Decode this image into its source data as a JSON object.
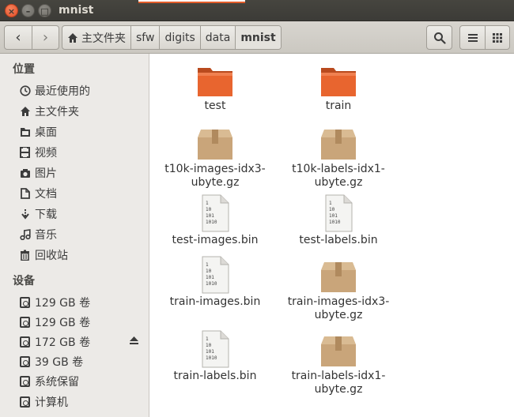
{
  "window": {
    "title": "mnist",
    "close_glyph": "×",
    "minimize_glyph": "–",
    "maximize_glyph": "□"
  },
  "toolbar": {
    "back_glyph": "‹",
    "forward_glyph": "›",
    "breadcrumbs": [
      {
        "label": "主文件夹",
        "icon": "home-icon"
      },
      {
        "label": "sfw"
      },
      {
        "label": "digits"
      },
      {
        "label": "data"
      },
      {
        "label": "mnist",
        "active": true
      }
    ]
  },
  "sidebar": {
    "places_heading": "位置",
    "places": [
      {
        "label": "最近使用的",
        "icon": "clock-icon"
      },
      {
        "label": "主文件夹",
        "icon": "home-icon"
      },
      {
        "label": "桌面",
        "icon": "desktop-icon"
      },
      {
        "label": "视频",
        "icon": "video-icon"
      },
      {
        "label": "图片",
        "icon": "camera-icon"
      },
      {
        "label": "文档",
        "icon": "document-icon"
      },
      {
        "label": "下载",
        "icon": "download-icon"
      },
      {
        "label": "音乐",
        "icon": "music-icon"
      },
      {
        "label": "回收站",
        "icon": "trash-icon"
      }
    ],
    "devices_heading": "设备",
    "devices": [
      {
        "label": "129 GB 卷",
        "icon": "drive-icon"
      },
      {
        "label": "129 GB 卷",
        "icon": "drive-icon"
      },
      {
        "label": "172 GB 卷",
        "icon": "drive-icon",
        "eject": true
      },
      {
        "label": "39 GB 卷",
        "icon": "drive-icon"
      },
      {
        "label": "系统保留",
        "icon": "drive-icon"
      },
      {
        "label": "计算机",
        "icon": "drive-icon"
      }
    ]
  },
  "files": [
    {
      "name_line1": "test",
      "name_line2": "",
      "type": "folder"
    },
    {
      "name_line1": "train",
      "name_line2": "",
      "type": "folder"
    },
    {
      "name_line1": "t10k-images-idx3-",
      "name_line2": "ubyte.gz",
      "type": "archive"
    },
    {
      "name_line1": "t10k-labels-idx1-",
      "name_line2": "ubyte.gz",
      "type": "archive"
    },
    {
      "name_line1": "test-images.bin",
      "name_line2": "",
      "type": "binary"
    },
    {
      "name_line1": "test-labels.bin",
      "name_line2": "",
      "type": "binary"
    },
    {
      "name_line1": "train-images.bin",
      "name_line2": "",
      "type": "binary"
    },
    {
      "name_line1": "train-images-idx3-",
      "name_line2": "ubyte.gz",
      "type": "archive"
    },
    {
      "name_line1": "train-labels.bin",
      "name_line2": "",
      "type": "binary"
    },
    {
      "name_line1": "train-labels-idx1-",
      "name_line2": "ubyte.gz",
      "type": "archive"
    }
  ],
  "binary_icon_text": [
    "1",
    "10",
    "101",
    "1010"
  ],
  "colors": {
    "folder": "#e8652f",
    "archive": "#c9a57a",
    "close_button": "#e95420"
  }
}
